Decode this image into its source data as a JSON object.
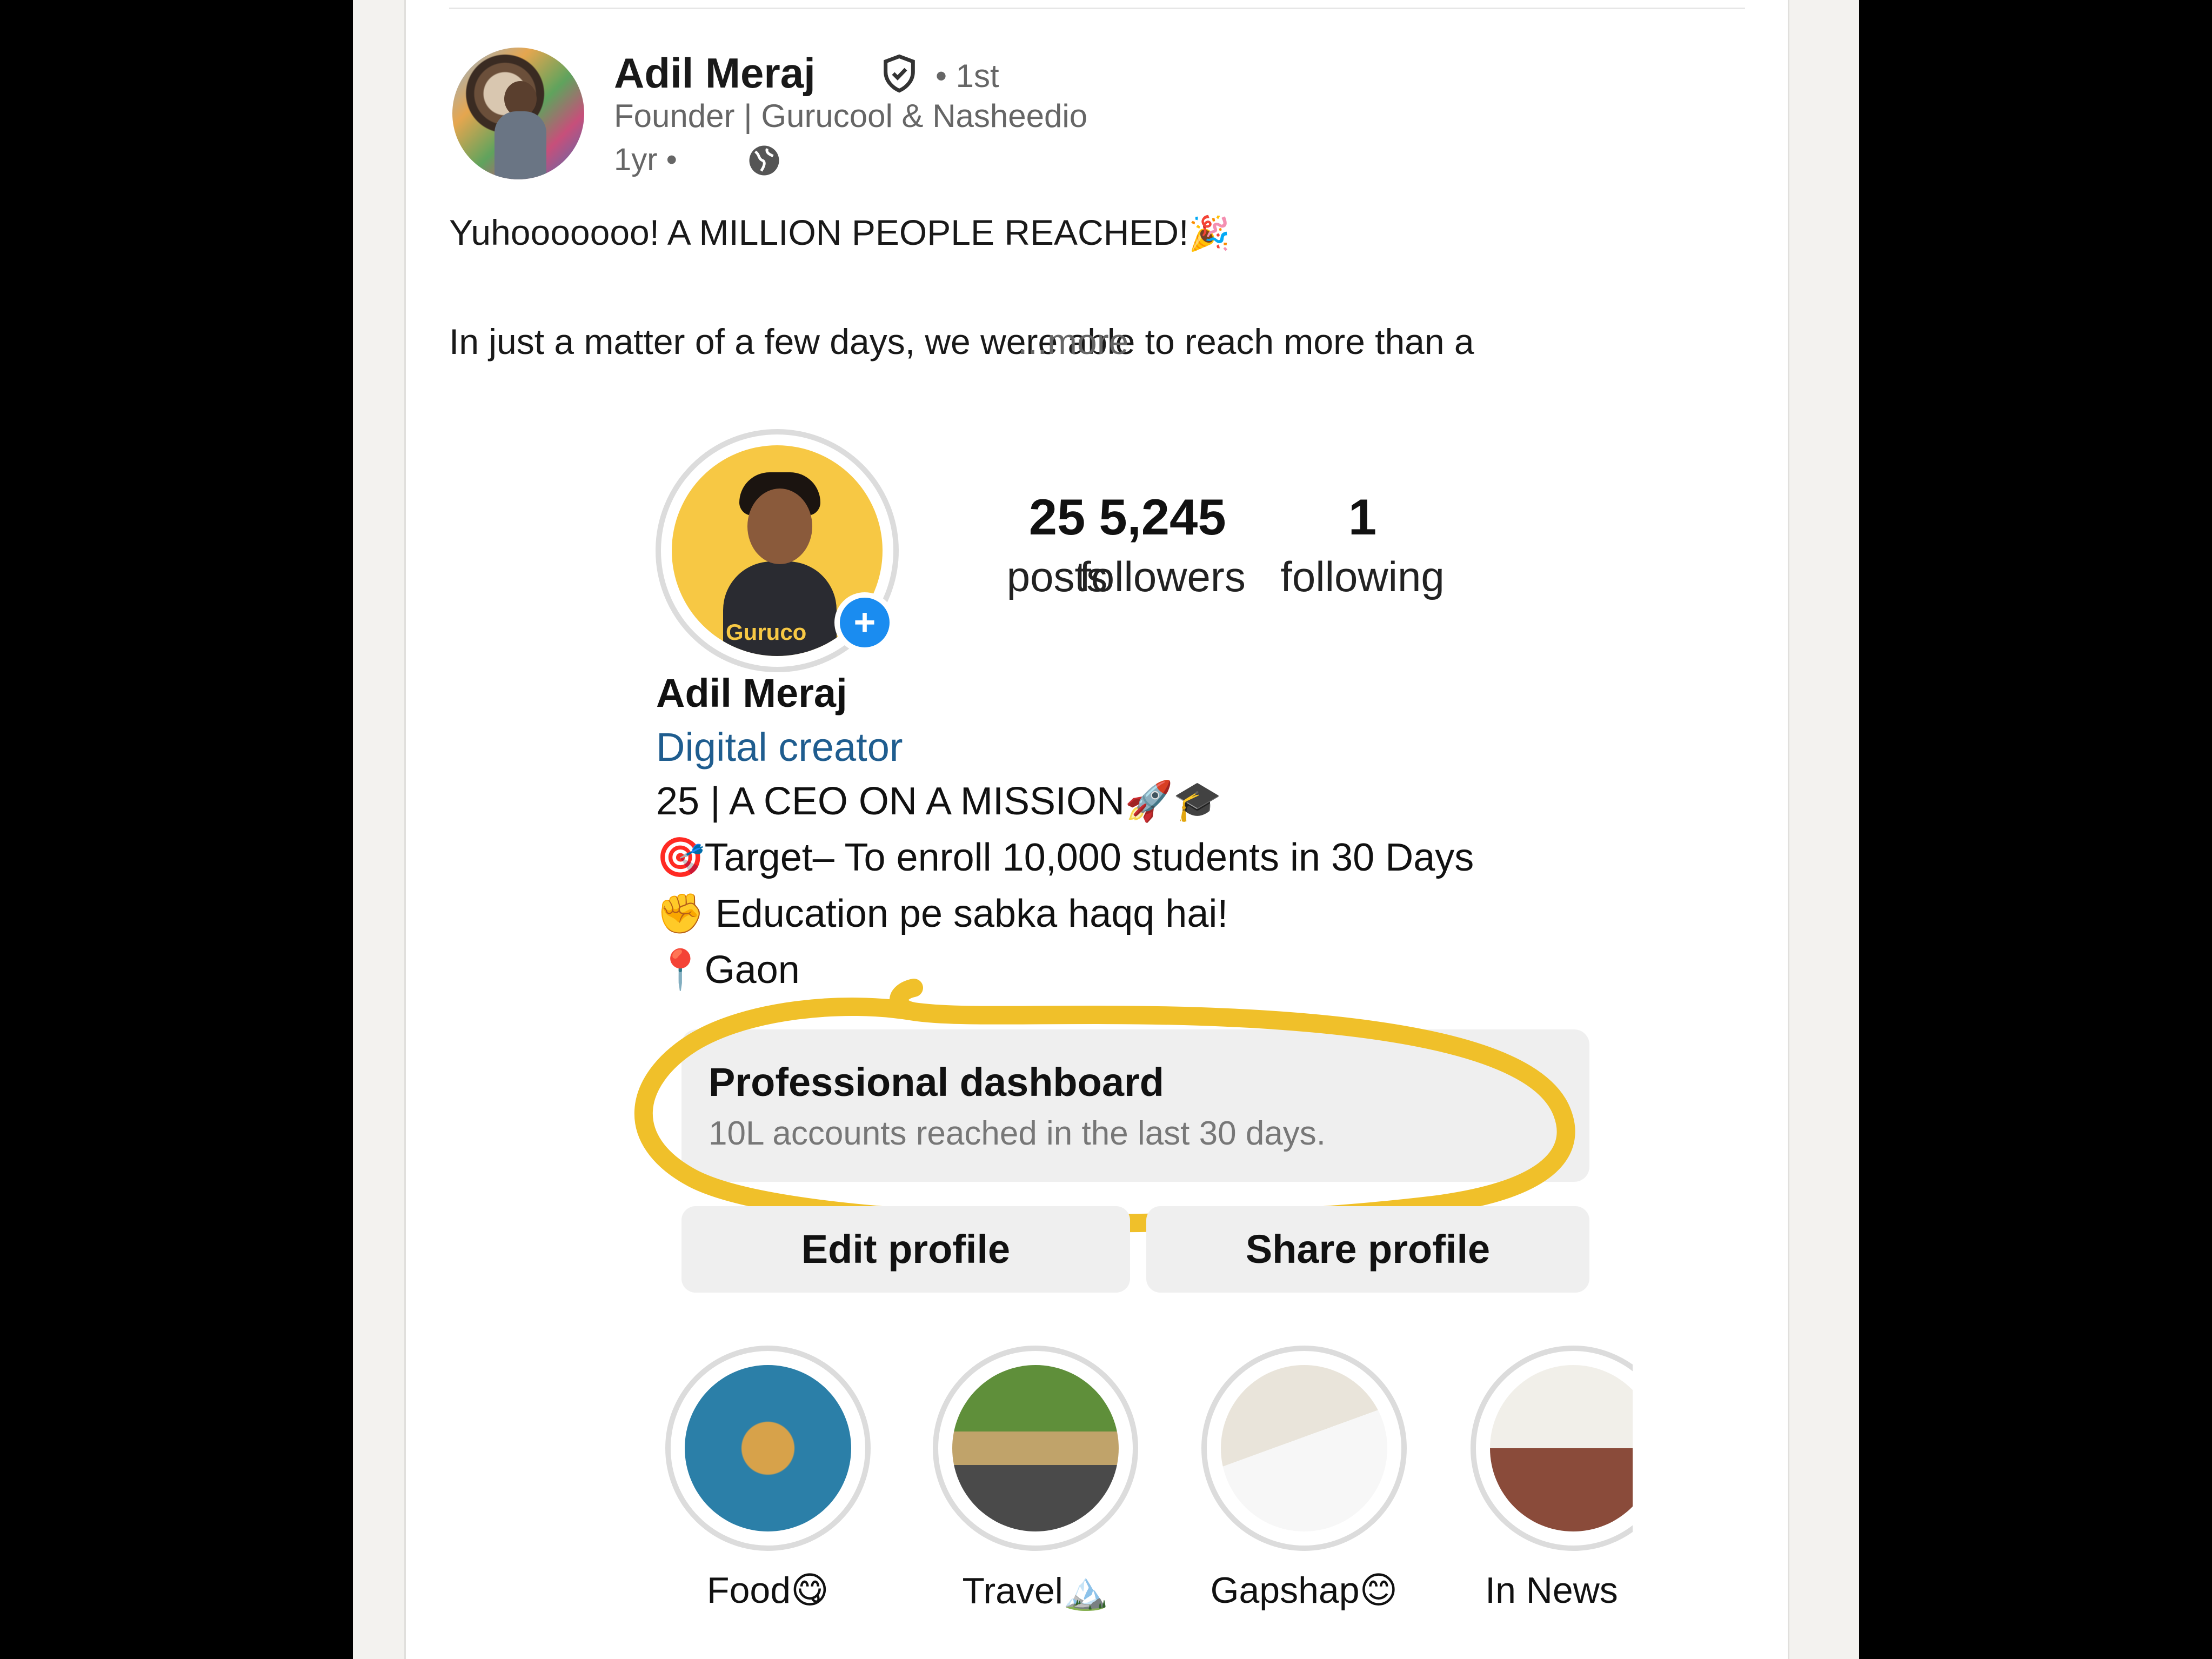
{
  "post": {
    "author_name": "Adil Meraj",
    "degree": "• 1st",
    "headline": "Founder | Gurucool & Nasheedio",
    "time": "1yr •",
    "line1": "Yuhooooooo! A MILLION PEOPLE REACHED!",
    "line1_emoji": "🎉",
    "line2": "In just a matter of a few days, we were able to reach more than a",
    "more_label": "...more"
  },
  "instagram": {
    "avatar_brand": "Guruco",
    "stats": [
      {
        "value": "25",
        "label": "posts"
      },
      {
        "value": "5,245",
        "label": "followers"
      },
      {
        "value": "1",
        "label": "following"
      }
    ],
    "name": "Adil Meraj",
    "category": "Digital creator",
    "bio": [
      "25 | A CEO ON A MISSION🚀🎓",
      "🎯Target– To enroll 10,000 students in 30 Days",
      "✊ Education pe sabka haqq hai!",
      "📍Gaon"
    ],
    "dashboard": {
      "title": "Professional dashboard",
      "subtitle": "10L accounts reached in the last 30 days."
    },
    "buttons": {
      "edit": "Edit profile",
      "share": "Share profile"
    },
    "highlights": [
      {
        "label": "Food😋"
      },
      {
        "label": "Travel🏔️"
      },
      {
        "label": "Gapshap😊"
      },
      {
        "label": "In News"
      }
    ]
  },
  "colors": {
    "highlight_ring": "#f0c02a",
    "add_button": "#1a8cf0",
    "category_text": "#1f5d8f"
  }
}
